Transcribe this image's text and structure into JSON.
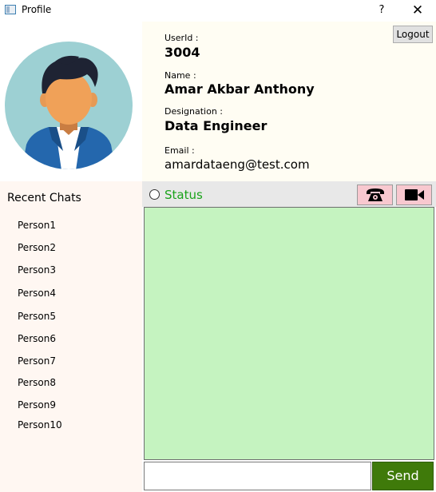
{
  "window": {
    "title": "Profile",
    "help_label": "?",
    "close_label": "✕"
  },
  "profile": {
    "userid_label": "UserId :",
    "userid": "3004",
    "name_label": "Name :",
    "name": "Amar Akbar Anthony",
    "designation_label": "Designation :",
    "designation": "Data Engineer",
    "email_label": "Email :",
    "email": "amardataeng@test.com",
    "logout_label": "Logout"
  },
  "sidebar": {
    "title": "Recent Chats",
    "items": [
      "Person1",
      "Person2",
      "Person3",
      "Person4",
      "Person5",
      "Person6",
      "Person7",
      "Person8",
      "Person9",
      "Person10"
    ]
  },
  "chat": {
    "status_label": "Status",
    "call_icon": "phone-icon",
    "video_icon": "video-camera-icon",
    "input_value": "",
    "send_label": "Send"
  },
  "colors": {
    "status_green": "#1aa31a",
    "chat_bg": "#c5f3c0",
    "send_bg": "#3f7a0a",
    "call_btn_bg": "#f8c8cf"
  }
}
